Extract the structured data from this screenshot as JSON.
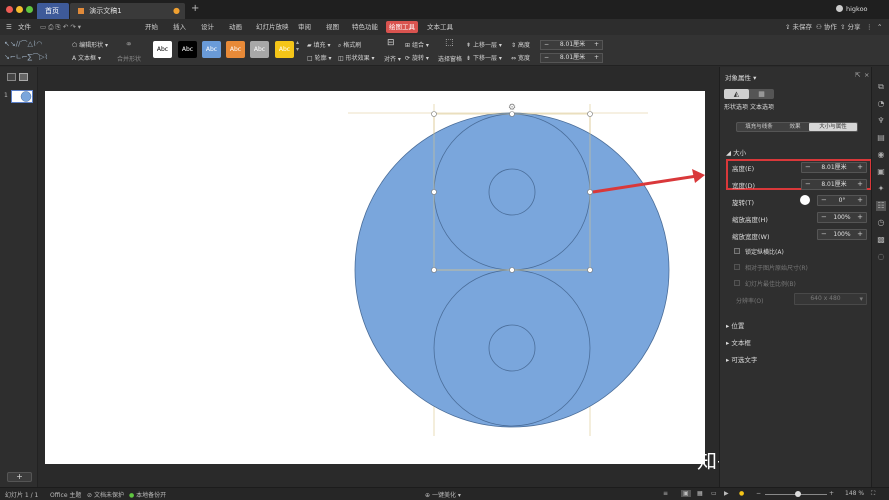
{
  "titlebar": {
    "tabs": [
      {
        "label": "首页"
      },
      {
        "label": "演示文稿1"
      }
    ],
    "add_tab": "+",
    "username": "higkoo"
  },
  "menubar": {
    "file_label": "文件",
    "items": [
      "开始",
      "插入",
      "设计",
      "动画",
      "幻灯片放映",
      "审阅",
      "视图",
      "特色功能",
      "绘图工具",
      "文本工具"
    ],
    "active_index": 8,
    "right": {
      "unsaved": "未保存",
      "collab": "协作",
      "share": "分享"
    }
  },
  "ribbon": {
    "edit_shape": "编辑形状",
    "text_box": "文本框",
    "merge_shape": "合并形状",
    "style_sample": "Abc",
    "style_colors": [
      "#ffffff",
      "#000000",
      "#6a9bd8",
      "#e88a38",
      "#a8a8a8",
      "#f5c518"
    ],
    "fill": "填充",
    "outline": "轮廓",
    "format_painter": "格式刷",
    "shape_effect": "形状效果",
    "align": "对齐",
    "group": "组合",
    "rotate": "旋转",
    "selection_pane": "选择窗格",
    "bring_forward": "上移一层",
    "send_backward": "下移一层",
    "height_label": "高度",
    "width_label": "宽度",
    "height_value": "8.01厘米",
    "width_value": "8.01厘米"
  },
  "leftpanel": {
    "slide_number": "1",
    "add_button": "+"
  },
  "panel": {
    "title": "对象属性",
    "tab_shape": "形状选项",
    "tab_text": "文本选项",
    "subtabs": [
      "填充与线条",
      "效果",
      "大小与属性"
    ],
    "active_subtab": 2,
    "section_size": "大小",
    "height_label": "高度(E)",
    "height_value": "8.01厘米",
    "width_label": "宽度(D)",
    "width_value": "8.01厘米",
    "rotation_label": "旋转(T)",
    "rotation_value": "0°",
    "scale_height_label": "缩放高度(H)",
    "scale_height_value": "100%",
    "scale_width_label": "缩放宽度(W)",
    "scale_width_value": "100%",
    "lock_ratio": "锁定纵横比(A)",
    "relative_original": "相对于图片原始尺寸(R)",
    "best_ratio": "幻灯片最佳比例(B)",
    "resolution_label": "分辨率(O)",
    "resolution_value": "640 x 480",
    "section_position": "位置",
    "section_textbox": "文本框",
    "section_alt_text": "可选文字"
  },
  "watermark": "知乎 @higkoo",
  "statusbar": {
    "slide_info": "幻灯片 1 / 1",
    "theme": "Office 主题",
    "doc_protect": "文档未保护",
    "backup": "本地备份开",
    "beautify": "一键美化",
    "zoom": "148 %"
  },
  "colors": {
    "accent": "#d9534f",
    "shape_fill": "#7aa6dc",
    "shape_stroke": "#4a6d99",
    "highlight_border": "#d9383a"
  }
}
